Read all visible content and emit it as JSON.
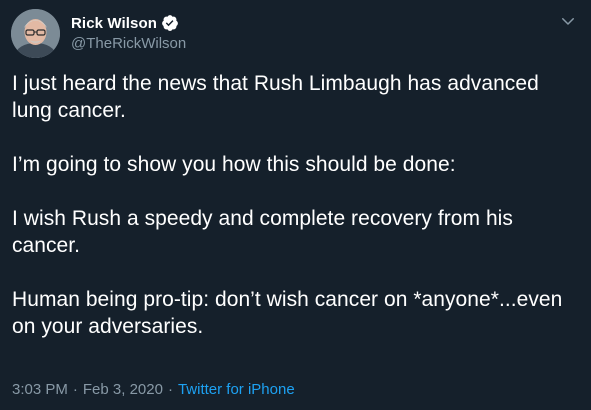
{
  "tweet": {
    "display_name": "Rick Wilson",
    "handle": "@TheRickWilson",
    "verified": true,
    "paragraphs": [
      "I just heard the news that Rush Limbaugh has advanced lung cancer.",
      "I’m going to show you how this should be done:",
      "I wish Rush a speedy and complete recovery from his cancer.",
      "Human being pro-tip: don’t wish cancer on *anyone*...even on your adversaries."
    ],
    "time": "3:03 PM",
    "separator": "·",
    "date": "Feb 3, 2020",
    "source": "Twitter for iPhone"
  },
  "icons": {
    "verified": "verified-badge-icon",
    "caret": "chevron-down-icon"
  },
  "colors": {
    "background": "#15202b",
    "secondary_text": "#8899a6",
    "link": "#1da1f2"
  }
}
